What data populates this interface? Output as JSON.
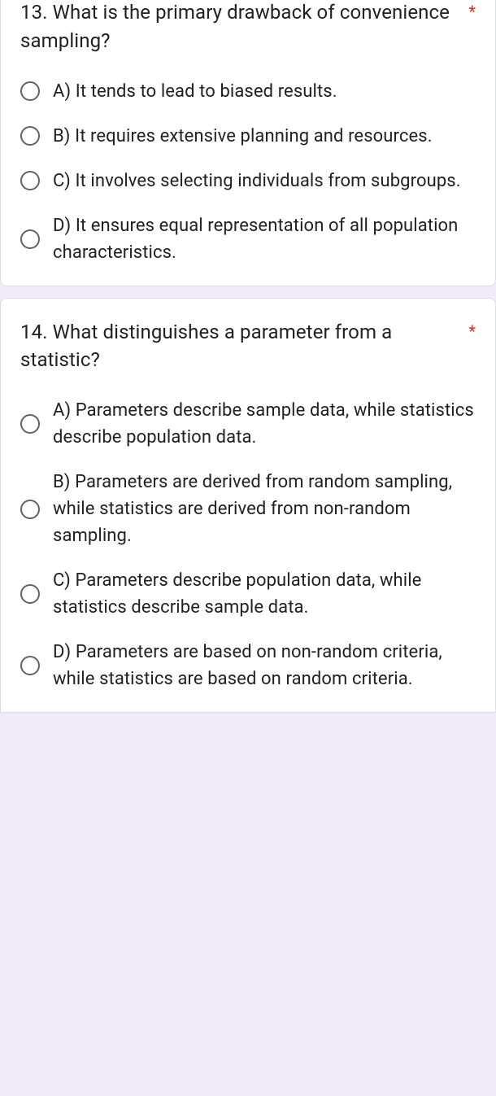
{
  "required_marker": "*",
  "questions": [
    {
      "prompt": "13. What is the primary drawback of convenience sampling?",
      "required": true,
      "options": [
        "A) It tends to lead to biased results.",
        "B) It requires extensive planning and resources.",
        "C) It involves selecting individuals from subgroups.",
        "D) It ensures equal representation of all population characteristics."
      ]
    },
    {
      "prompt": "14. What distinguishes a parameter from a statistic?",
      "required": true,
      "options": [
        "A) Parameters describe sample data, while statistics describe population data.",
        "B) Parameters are derived from random sampling, while statistics are derived from non-random sampling.",
        "C) Parameters describe population data, while statistics describe sample data.",
        "D) Parameters are based on non-random criteria, while statistics are based on random criteria."
      ]
    }
  ]
}
